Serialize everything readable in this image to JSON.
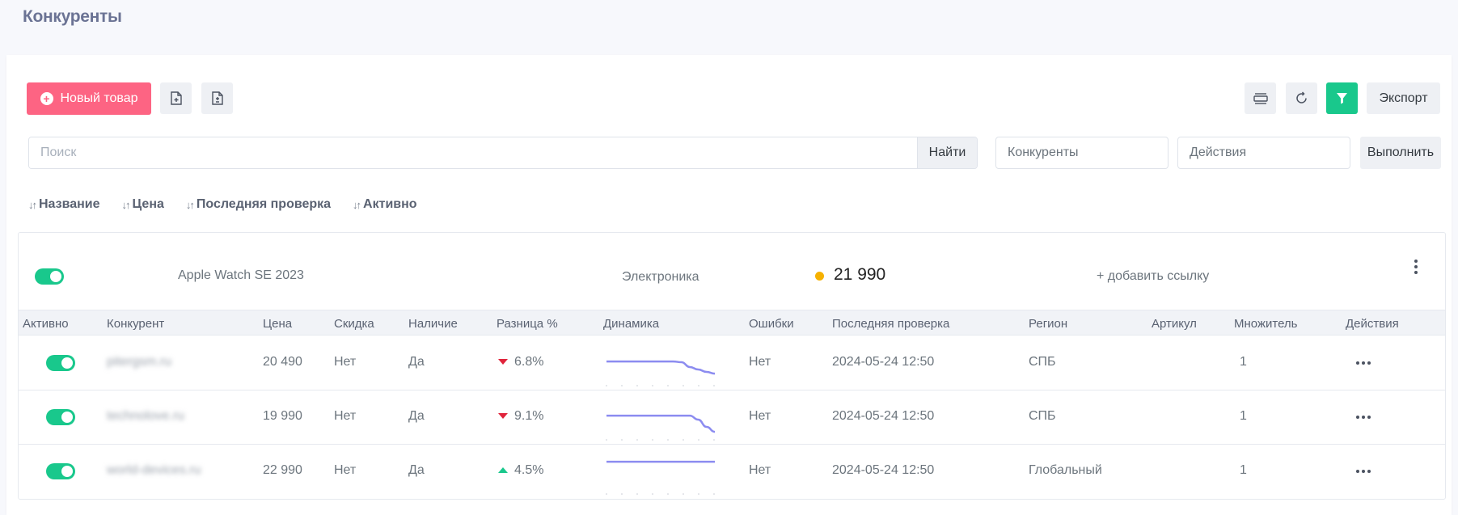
{
  "page": {
    "title": "Конкуренты"
  },
  "toolbar": {
    "new_item_label": "Новый товар",
    "export_label": "Экспорт",
    "icons": [
      "plus-circle-icon",
      "file-plus-icon",
      "file-diff-icon",
      "view-rows-icon",
      "refresh-icon",
      "filter-icon"
    ],
    "filter_color": "#19c88c",
    "new_item_color": "#fd6483"
  },
  "search": {
    "placeholder": "Поиск",
    "button_label": "Найти",
    "competitors_select": "Конкуренты",
    "actions_select": "Действия",
    "run_label": "Выполнить"
  },
  "sort": {
    "items": [
      "Название",
      "Цена",
      "Последняя проверка",
      "Активно"
    ]
  },
  "product": {
    "active": true,
    "name": "Apple Watch SE 2023",
    "category": "Электроника",
    "price": "21 990",
    "status_color": "#f6b100",
    "add_link_label": "+ добавить ссылку"
  },
  "table": {
    "headers": {
      "active": "Активно",
      "competitor": "Конкурент",
      "price": "Цена",
      "discount": "Скидка",
      "stock": "Наличие",
      "diff": "Разница %",
      "dynamics": "Динамика",
      "errors": "Ошибки",
      "last_check": "Последняя проверка",
      "region": "Регион",
      "sku": "Артикул",
      "multiplier": "Множитель",
      "actions": "Действия"
    },
    "rows": [
      {
        "active": true,
        "competitor": "pitergsm.ru",
        "price": "20 490",
        "discount": "Нет",
        "stock": "Да",
        "diff": "6.8%",
        "diff_dir": "down",
        "dynamics": [
          21990,
          21990,
          21990,
          21990,
          21990,
          21990,
          21990,
          21990,
          21990,
          21900,
          21300,
          21000,
          20700,
          20490
        ],
        "errors": "Нет",
        "last_check": "2024-05-24 12:50",
        "region": "СПБ",
        "sku": "",
        "multiplier": "1"
      },
      {
        "active": true,
        "competitor": "technolove.ru",
        "price": "19 990",
        "discount": "Нет",
        "stock": "Да",
        "diff": "9.1%",
        "diff_dir": "down",
        "dynamics": [
          21990,
          21990,
          21990,
          21990,
          21990,
          21990,
          21990,
          21990,
          21990,
          21990,
          21990,
          21500,
          20600,
          19990
        ],
        "errors": "Нет",
        "last_check": "2024-05-24 12:50",
        "region": "СПБ",
        "sku": "",
        "multiplier": "1"
      },
      {
        "active": true,
        "competitor": "world-devices.ru",
        "price": "22 990",
        "discount": "Нет",
        "stock": "Да",
        "diff": "4.5%",
        "diff_dir": "up",
        "dynamics": [
          22990,
          22990,
          22990,
          22990,
          22990,
          22990,
          22990,
          22990,
          22990,
          22990,
          22990,
          22990,
          22990,
          22990
        ],
        "errors": "Нет",
        "last_check": "2024-05-24 12:50",
        "region": "Глобальный",
        "sku": "",
        "multiplier": "1"
      }
    ],
    "sparkline_color": "#8c8cf0"
  }
}
